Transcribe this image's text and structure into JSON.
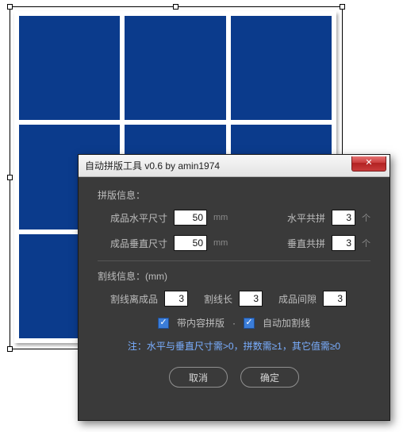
{
  "dialog": {
    "title": "自动拼版工具 v0.6    by amin1974",
    "close_glyph": "✕",
    "imposition": {
      "section_label": "拼版信息：",
      "h_size_label": "成品水平尺寸",
      "h_size_value": "50",
      "h_size_unit": "mm",
      "h_count_label": "水平共拼",
      "h_count_value": "3",
      "h_count_unit": "个",
      "v_size_label": "成品垂直尺寸",
      "v_size_value": "50",
      "v_size_unit": "mm",
      "v_count_label": "垂直共拼",
      "v_count_value": "3",
      "v_count_unit": "个"
    },
    "cut": {
      "section_label": "割线信息：(mm)",
      "offset_label": "割线离成品",
      "offset_value": "3",
      "length_label": "割线长",
      "length_value": "3",
      "gap_label": "成品间隙",
      "gap_value": "3"
    },
    "checks": {
      "with_content_label": "带内容拼版",
      "auto_cut_label": "自动加割线"
    },
    "note": "注：水平与垂直尺寸需>0，拼数需≥1，其它值需≥0",
    "buttons": {
      "cancel": "取消",
      "ok": "确定"
    }
  }
}
